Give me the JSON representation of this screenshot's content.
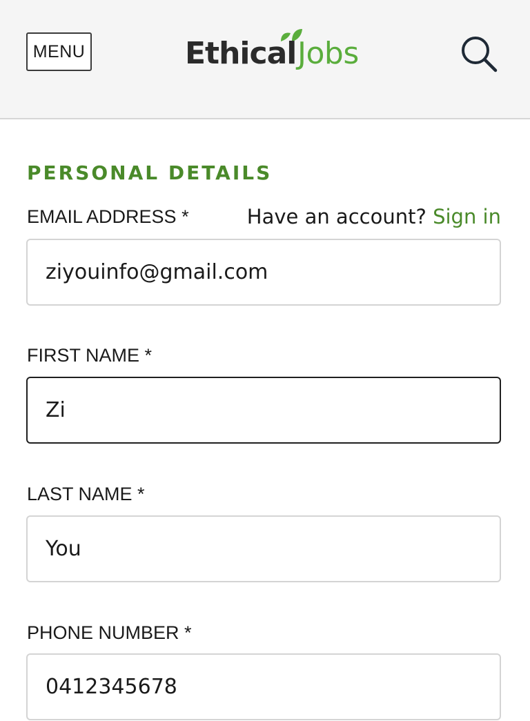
{
  "header": {
    "menu_label": "MENU",
    "logo_part1": "Ethical",
    "logo_part2": "Jobs",
    "search_icon": "search-icon",
    "brand_color": "#5aad3c"
  },
  "form": {
    "section_title": "PERSONAL DETAILS",
    "account_prompt": "Have an account?",
    "sign_in_label": "Sign in",
    "accent_color": "#4a8a2a",
    "fields": {
      "email": {
        "label": "EMAIL ADDRESS *",
        "value": "ziyouinfo@gmail.com"
      },
      "first_name": {
        "label": "FIRST NAME *",
        "value": "Zi"
      },
      "last_name": {
        "label": "LAST NAME *",
        "value": "You"
      },
      "phone": {
        "label": "PHONE NUMBER *",
        "value": "0412345678"
      }
    }
  }
}
